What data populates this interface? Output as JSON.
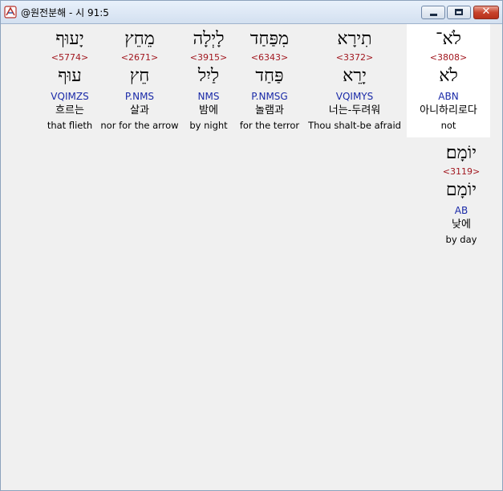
{
  "window": {
    "title": "@원전분해 - 시 91:5",
    "icon": "app-icon",
    "buttons": {
      "minimize": "minimize-icon",
      "maximize": "maximize-icon",
      "close": "✕"
    }
  },
  "words": [
    {
      "hebrew": "לֹא־",
      "strong": "<3808>",
      "lemma": "לֹא",
      "morph": "ABN",
      "korean": "아니하리로다",
      "english": "not"
    },
    {
      "hebrew": "תִירָא",
      "strong": "<3372>",
      "lemma": "יָרֵא",
      "morph": "VQIMYS",
      "korean": "너는-두려워",
      "english": "Thou shalt-be afraid"
    },
    {
      "hebrew": "מִפַּחַד",
      "strong": "<6343>",
      "lemma": "פַּחַד",
      "morph": "P.NMSG",
      "korean": "놀램과",
      "english": "for the terror"
    },
    {
      "hebrew": "לָיְלָה",
      "strong": "<3915>",
      "lemma": "לַיִל",
      "morph": "NMS",
      "korean": "밤에",
      "english": "by night"
    },
    {
      "hebrew": "מֵחֵץ",
      "strong": "<2671>",
      "lemma": "חֵץ",
      "morph": "P.NMS",
      "korean": "살과",
      "english": "nor for the arrow"
    },
    {
      "hebrew": "יָעוּף",
      "strong": "<5774>",
      "lemma": "עוּף",
      "morph": "VQIMZS",
      "korean": "흐르는",
      "english": "that flieth"
    },
    {
      "hebrew": "יוֹמָם׃",
      "strong": "<3119>",
      "lemma": "יוֹמָם",
      "morph": "AB",
      "korean": "낮에",
      "english": "by day"
    }
  ]
}
